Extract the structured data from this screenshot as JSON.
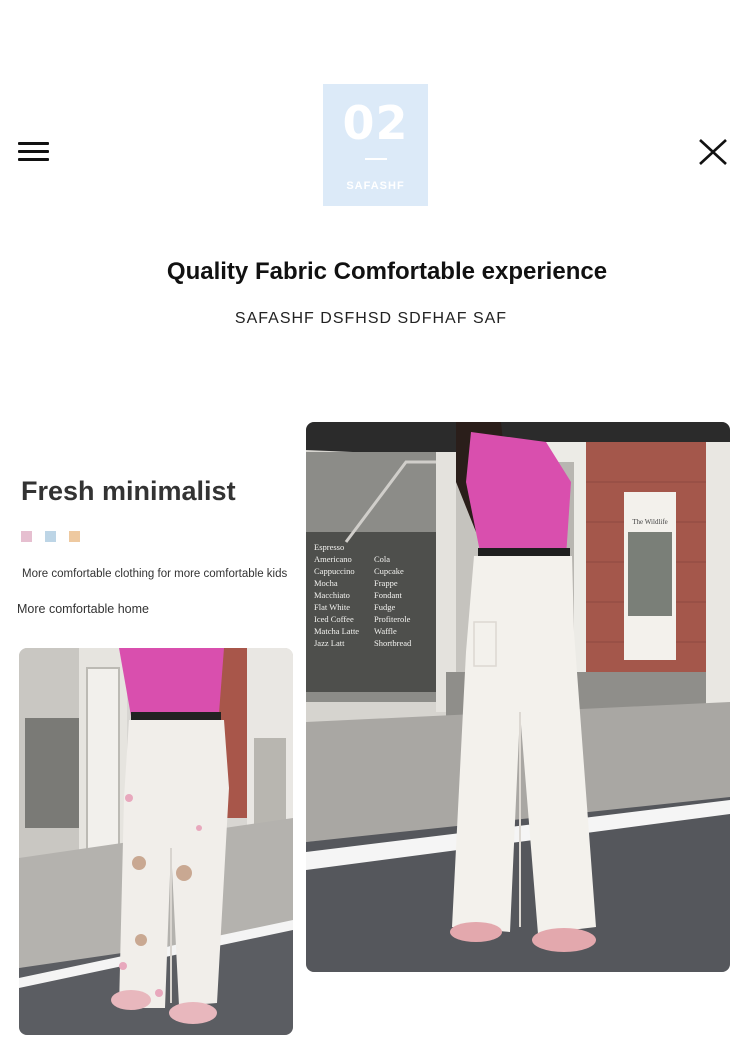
{
  "header": {
    "menu_icon": "hamburger-menu-icon",
    "close_label": "X"
  },
  "badge": {
    "number": "02",
    "text": "SAFASHF",
    "color": "#dceaf8"
  },
  "headline": "Quality Fabric Comfortable experience",
  "subheadline": "SAFASHF DSFHSD SDFHAF SAF",
  "section": {
    "title": "Fresh minimalist",
    "swatches": [
      "#e6bfd0",
      "#bdd5e6",
      "#eec9a0"
    ],
    "caption_kids": "More comfortable clothing for more comfortable kids",
    "caption_home": "More comfortable home"
  },
  "photos": {
    "small": {
      "description_icon": "model-white-bear-jeans-photo"
    },
    "large": {
      "description_icon": "model-white-wide-jeans-street-photo",
      "menu_board": [
        "Espresso",
        "Americano",
        "Cappuccino",
        "Mocha",
        "Macchiato",
        "Flat White",
        "Iced Coffee",
        "Matcha Latte",
        "Jazz Latt"
      ],
      "menu_board_2": [
        "Cola",
        "Cupcake",
        "Frappe",
        "Fondant",
        "Fudge",
        "Profiterole",
        "Waffle",
        "Shortbread"
      ],
      "poster_title": "The Wildlife"
    }
  }
}
